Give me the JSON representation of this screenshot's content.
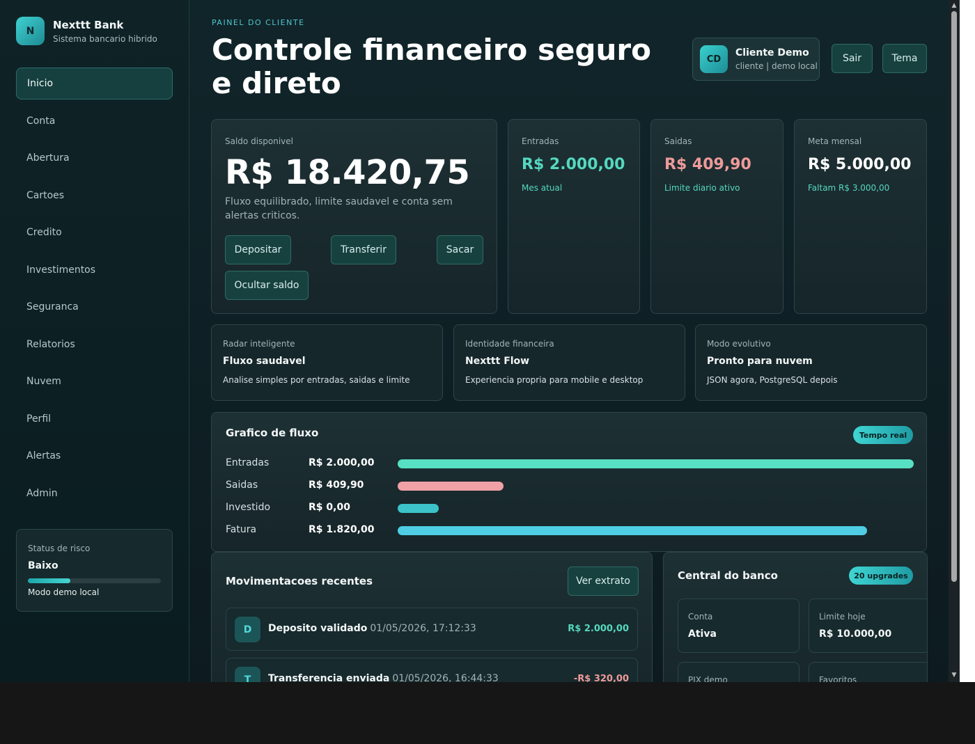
{
  "brand": {
    "logo": "N",
    "name": "Nexttt Bank",
    "subtitle": "Sistema bancario hibrido"
  },
  "nav": {
    "items": [
      {
        "label": "Inicio",
        "active": true
      },
      {
        "label": "Conta"
      },
      {
        "label": "Abertura"
      },
      {
        "label": "Cartoes"
      },
      {
        "label": "Credito"
      },
      {
        "label": "Investimentos"
      },
      {
        "label": "Seguranca"
      },
      {
        "label": "Relatorios"
      },
      {
        "label": "Nuvem"
      },
      {
        "label": "Perfil"
      },
      {
        "label": "Alertas"
      },
      {
        "label": "Admin"
      }
    ]
  },
  "risk": {
    "label": "Status de risco",
    "value": "Baixo",
    "level": 0.32,
    "note": "Modo demo local"
  },
  "header": {
    "eyebrow": "PAINEL DO CLIENTE",
    "title": "Controle financeiro seguro e direto",
    "user": {
      "initials": "CD",
      "name": "Cliente Demo",
      "role": "cliente | demo local"
    },
    "logout_label": "Sair",
    "theme_label": "Tema"
  },
  "balance": {
    "label": "Saldo disponivel",
    "value": "R$ 18.420,75",
    "description": "Fluxo equilibrado, limite saudavel e conta sem alertas criticos.",
    "actions": {
      "deposit": "Depositar",
      "transfer": "Transferir",
      "withdraw": "Sacar",
      "hide": "Ocultar saldo"
    }
  },
  "stats": [
    {
      "label": "Entradas",
      "value": "R$ 2.000,00",
      "note": "Mes atual",
      "color": "#55d8bf"
    },
    {
      "label": "Saidas",
      "value": "R$ 409,90",
      "note": "Limite diario ativo",
      "color": "#ef9a9a"
    },
    {
      "label": "Meta mensal",
      "value": "R$ 5.000,00",
      "note": "Faltam R$ 3.000,00",
      "color": "#ffffff"
    }
  ],
  "insights": [
    {
      "label": "Radar inteligente",
      "title": "Fluxo saudavel",
      "desc": "Analise simples por entradas, saidas e limite"
    },
    {
      "label": "Identidade financeira",
      "title": "Nexttt Flow",
      "desc": "Experiencia propria para mobile e desktop"
    },
    {
      "label": "Modo evolutivo",
      "title": "Pronto para nuvem",
      "desc": "JSON agora, PostgreSQL depois"
    }
  ],
  "flow": {
    "title": "Grafico de fluxo",
    "badge": "Tempo real",
    "rows": [
      {
        "label": "Entradas",
        "value": "R$ 2.000,00",
        "fraction": 1.0,
        "color": "#57e0c3"
      },
      {
        "label": "Saidas",
        "value": "R$ 409,90",
        "fraction": 0.205,
        "color": "#f0a1a6"
      },
      {
        "label": "Investido",
        "value": "R$ 0,00",
        "fraction": 0.08,
        "color": "#3bc3c8"
      },
      {
        "label": "Fatura",
        "value": "R$ 1.820,00",
        "fraction": 0.91,
        "color": "#4fcde4"
      }
    ]
  },
  "movements": {
    "title": "Movimentacoes recentes",
    "statement_label": "Ver extrato",
    "items": [
      {
        "icon": "D",
        "title": "Deposito validado",
        "date": "01/05/2026, 17:12:33",
        "amount": "R$ 2.000,00",
        "color": "#55d8bf"
      },
      {
        "icon": "T",
        "title": "Transferencia enviada",
        "date": "01/05/2026, 16:44:33",
        "amount": "-R$ 320,00",
        "color": "#ef9a9a"
      }
    ]
  },
  "central": {
    "title": "Central do banco",
    "badge": "20 upgrades",
    "tiles": [
      {
        "label": "Conta",
        "value": "Ativa"
      },
      {
        "label": "Limite hoje",
        "value": "R$ 10.000,00"
      },
      {
        "label": "PIX demo",
        "value": ""
      },
      {
        "label": "Favoritos",
        "value": ""
      }
    ]
  }
}
